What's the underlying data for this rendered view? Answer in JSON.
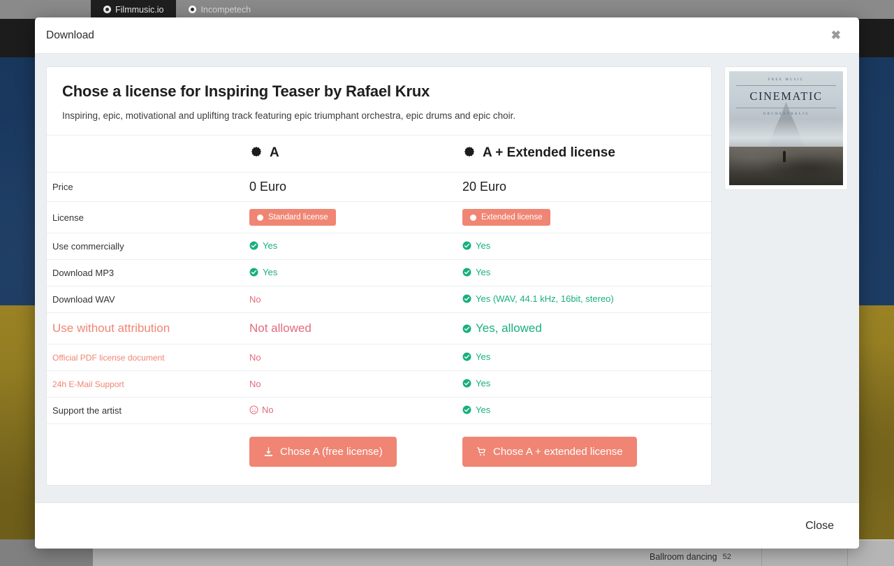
{
  "browser": {
    "tabs": [
      {
        "label": "Filmmusic.io",
        "active": true,
        "icon": "circle-record-icon"
      },
      {
        "label": "Incompetech",
        "active": false,
        "icon": "circle-record-icon"
      }
    ]
  },
  "background": {
    "tag_label": "Ballroom dancing",
    "tag_count": "52"
  },
  "modal": {
    "title": "Download",
    "close_x": "✖",
    "close_button": "Close"
  },
  "card": {
    "title": "Chose a license for Inspiring Teaser by Rafael Krux",
    "subtitle": "Inspiring, epic, motivational and uplifting track featuring epic triumphant orchestra, epic drums and epic choir."
  },
  "album": {
    "kicker": "FREE MUSIC",
    "main": "CINEMATIC",
    "sub": "ORCHESTRALIS"
  },
  "columns": {
    "feature_header": "",
    "plan_a": "A",
    "plan_a_extended": "A + Extended license"
  },
  "rows": [
    {
      "label": "Price",
      "a": "0 Euro",
      "ae": "20 Euro",
      "type": "price"
    },
    {
      "label": "License",
      "a": "Standard license",
      "ae": "Extended license",
      "type": "badge"
    },
    {
      "label": "Use commercially",
      "a": "Yes",
      "a_state": "yes",
      "ae": "Yes",
      "ae_state": "yes",
      "type": "value"
    },
    {
      "label": "Download MP3",
      "a": "Yes",
      "a_state": "yes",
      "ae": "Yes",
      "ae_state": "yes",
      "type": "value"
    },
    {
      "label": "Download WAV",
      "a": "No",
      "a_state": "no-plain",
      "ae": "Yes (WAV, 44.1 kHz, 16bit, stereo)",
      "ae_state": "yes",
      "type": "value"
    },
    {
      "label": "Use without attribution",
      "a": "Not allowed",
      "a_state": "no-plain",
      "ae": "Yes, allowed",
      "ae_state": "yes",
      "type": "value",
      "emphasis": "highlight"
    },
    {
      "label": "Official PDF license document",
      "a": "No",
      "a_state": "no-plain",
      "ae": "Yes",
      "ae_state": "yes",
      "type": "value",
      "emphasis": "pink-label"
    },
    {
      "label": "24h E-Mail Support",
      "a": "No",
      "a_state": "no-plain",
      "ae": "Yes",
      "ae_state": "yes",
      "type": "value",
      "emphasis": "pink-label"
    },
    {
      "label": "Support the artist",
      "a": "No",
      "a_state": "no-sad",
      "ae": "Yes",
      "ae_state": "yes",
      "type": "value"
    }
  ],
  "actions": {
    "free_button": "Chose A (free license)",
    "free_button_icon": "download-icon",
    "extended_button": "Chose A + extended license",
    "extended_button_icon": "shopping-cart-icon"
  },
  "colors": {
    "accent_salmon": "#f08573",
    "yes_green": "#18b07b",
    "no_pink": "#e36a7d",
    "modal_body_bg": "#eceff1"
  }
}
